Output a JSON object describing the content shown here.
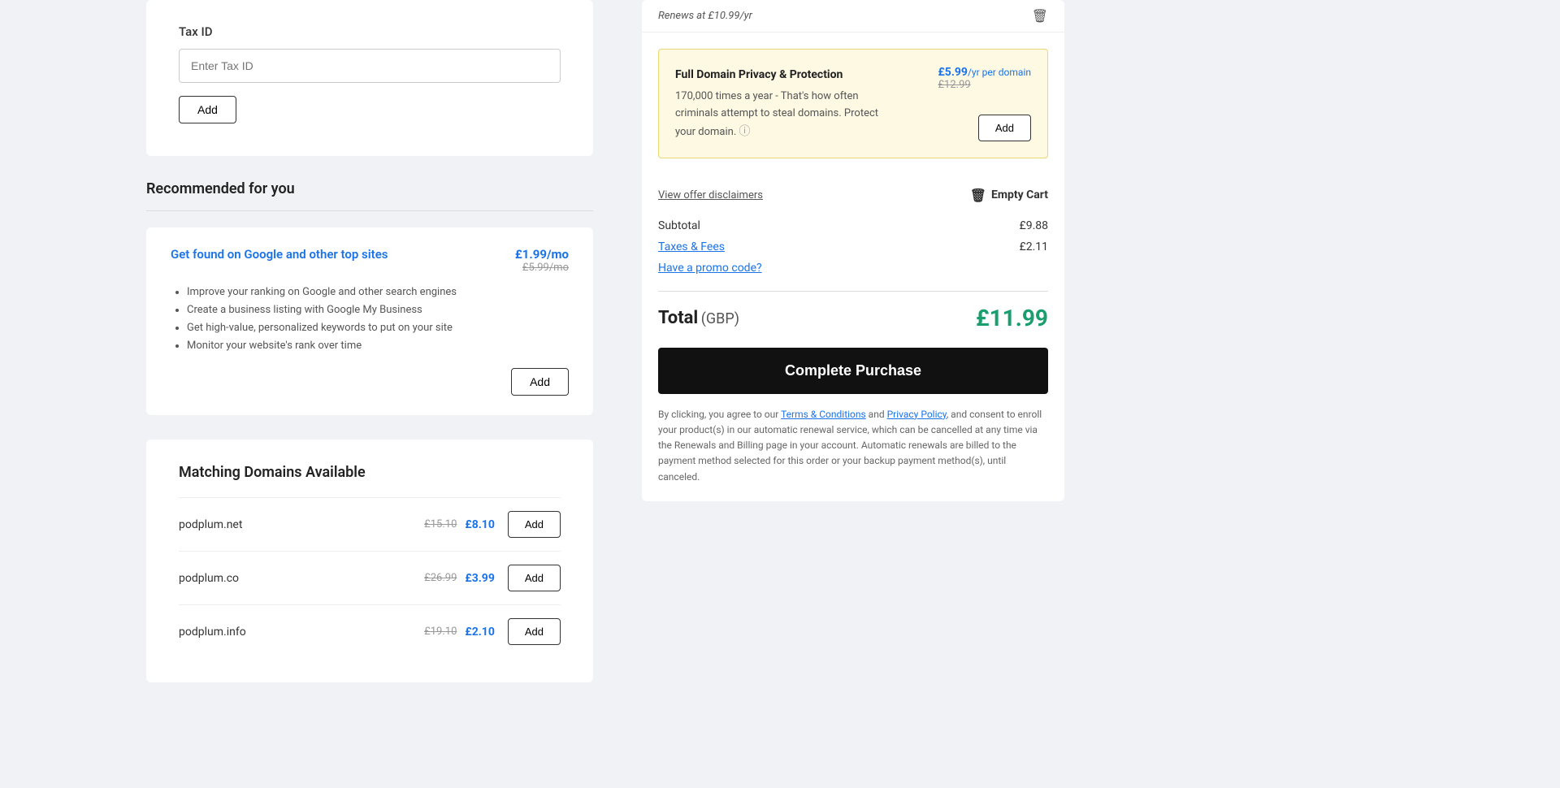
{
  "left": {
    "taxId": {
      "label": "Tax ID",
      "placeholder": "Enter Tax ID",
      "addButton": "Add"
    },
    "recommended": {
      "title": "Recommended for you",
      "items": [
        {
          "title": "Get found on Google and other top sites",
          "priceMain": "£1.99/mo",
          "priceOld": "£5.99/mo",
          "features": [
            "Improve your ranking on Google and other search engines",
            "Create a business listing with Google My Business",
            "Get high-value, personalized keywords to put on your site",
            "Monitor your website's rank over time"
          ],
          "addButton": "Add"
        }
      ]
    },
    "matching": {
      "title": "Matching Domains Available",
      "domains": [
        {
          "name": "podplum.net",
          "priceOld": "£15.10",
          "priceNew": "£8.10",
          "addButton": "Add"
        },
        {
          "name": "podplum.co",
          "priceOld": "£26.99",
          "priceNew": "£3.99",
          "addButton": "Add"
        },
        {
          "name": "podplum.info",
          "priceOld": "£19.10",
          "priceNew": "£2.10",
          "addButton": "Add"
        }
      ]
    }
  },
  "right": {
    "topItemText": "Renews at £10.99/yr",
    "upsell": {
      "bodyText": "170,000 times a year - That's how often criminals attempt to steal domains. Protect your domain.",
      "title": "Full Domain Privacy & Protection",
      "priceMain": "£5.99",
      "pricePeriod": "/yr per domain",
      "priceOld": "£12.99",
      "addButton": "Add"
    },
    "viewDisclaimers": "View offer disclaimers",
    "emptyCart": "Empty Cart",
    "subtotalLabel": "Subtotal",
    "subtotalValue": "£9.88",
    "taxesLabel": "Taxes & Fees",
    "taxesValue": "£2.11",
    "promoLabel": "Have a promo code?",
    "totalLabel": "Total",
    "totalCurrency": "(GBP)",
    "totalAmount": "£11.99",
    "completePurchaseBtn": "Complete Purchase",
    "legalText1": "By clicking, you agree to our ",
    "legalLink1": "Terms & Conditions",
    "legalText2": " and ",
    "legalLink2": "Privacy Policy",
    "legalText3": ", and consent to enroll your product(s) in our automatic renewal service, which can be cancelled at any time via the Renewals and Billing page in your account. Automatic renewals are billed to the payment method selected for this order or your backup payment method(s), until canceled."
  }
}
